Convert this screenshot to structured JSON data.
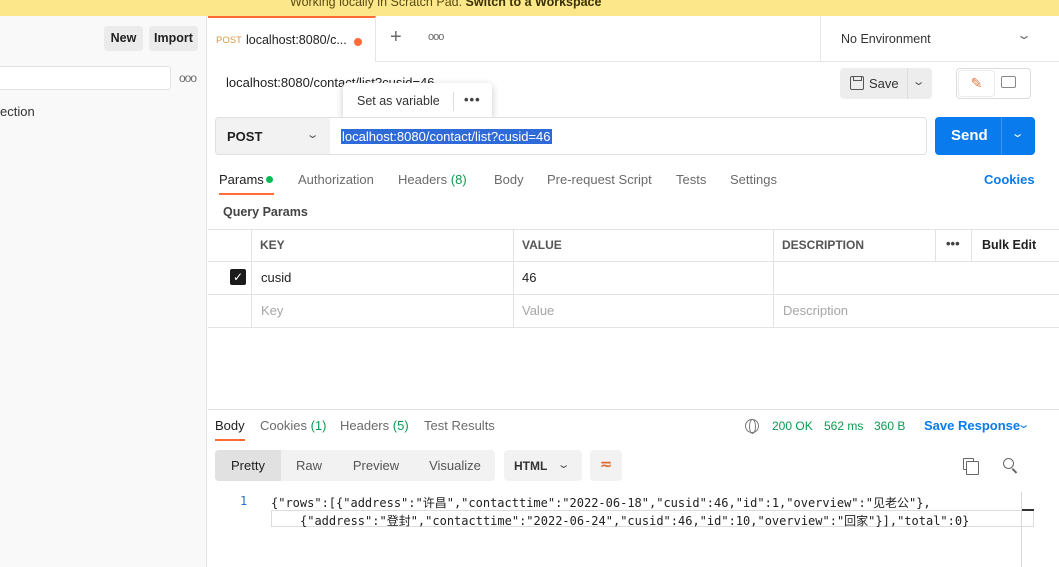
{
  "banner": {
    "text": "Working locally in Scratch Pad. ",
    "link": "Switch to a Workspace"
  },
  "sidebar": {
    "new_label": "New",
    "import_label": "Import",
    "more": "ooo",
    "collection_partial": "ection"
  },
  "tabs": {
    "method": "POST",
    "title": "localhost:8080/c...",
    "add": "+",
    "more": "ooo"
  },
  "environment": {
    "label": "No Environment"
  },
  "request": {
    "title": "localhost:8080/contact/list?cusid=46",
    "popup_label": "Set as variable",
    "popup_more": "•••",
    "save_label": "Save",
    "method": "POST",
    "url": "localhost:8080/contact/list?cusid=46",
    "send_label": "Send"
  },
  "request_tabs": {
    "params": "Params",
    "authorization": "Authorization",
    "headers": "Headers",
    "headers_count": "(8)",
    "body": "Body",
    "prerequest": "Pre-request Script",
    "tests": "Tests",
    "settings": "Settings",
    "cookies": "Cookies"
  },
  "params": {
    "section_label": "Query Params",
    "columns": [
      "KEY",
      "VALUE",
      "DESCRIPTION"
    ],
    "more": "•••",
    "bulk_edit": "Bulk Edit",
    "rows": [
      {
        "key": "cusid",
        "value": "46",
        "description": "",
        "checked": true
      }
    ],
    "placeholders": {
      "key": "Key",
      "value": "Value",
      "description": "Description"
    }
  },
  "response": {
    "tabs": {
      "body": "Body",
      "cookies": "Cookies",
      "cookies_count": "(1)",
      "headers": "Headers",
      "headers_count": "(5)",
      "test_results": "Test Results"
    },
    "status": "200 OK",
    "time": "562 ms",
    "size": "360 B",
    "save_response": "Save Response",
    "formats": [
      "Pretty",
      "Raw",
      "Preview",
      "Visualize"
    ],
    "language": "HTML",
    "line_number": "1",
    "code_line1": "{\"rows\":[{\"address\":\"许昌\",\"contacttime\":\"2022-06-18\",\"cusid\":46,\"id\":1,\"overview\":\"见老公\"},",
    "code_line2": "{\"address\":\"登封\",\"contacttime\":\"2022-06-24\",\"cusid\":46,\"id\":10,\"overview\":\"回家\"}],\"total\":0}"
  },
  "colors": {
    "accent": "#ff6c37",
    "primary": "#097bed",
    "success": "#0cbb52",
    "banner": "#fce88a"
  }
}
